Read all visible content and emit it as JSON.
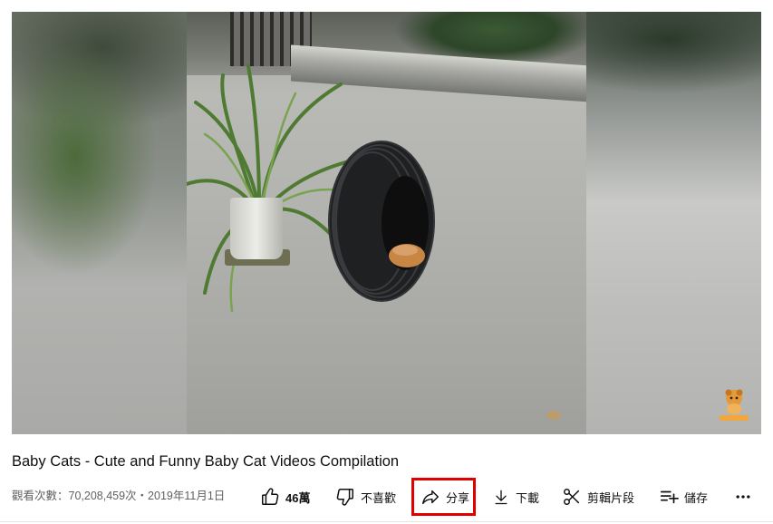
{
  "video": {
    "title": "Baby Cats - Cute and Funny Baby Cat Videos Compilation",
    "meta": "觀看次數：70,208,459次・2019年11月1日"
  },
  "actions": {
    "like_count": "46萬",
    "dislike_label": "不喜歡",
    "share_label": "分享",
    "download_label": "下載",
    "clip_label": "剪輯片段",
    "save_label": "儲存",
    "more_label": "..."
  },
  "icons": {
    "like": "thumbs-up-icon",
    "dislike": "thumbs-down-icon",
    "share": "share-arrow-icon",
    "download": "download-icon",
    "clip": "scissors-icon",
    "save": "playlist-add-icon",
    "more": "more-horizontal-icon"
  },
  "colors": {
    "highlight": "#e00000",
    "text_primary": "#0f0f0f",
    "text_secondary": "#606060"
  }
}
